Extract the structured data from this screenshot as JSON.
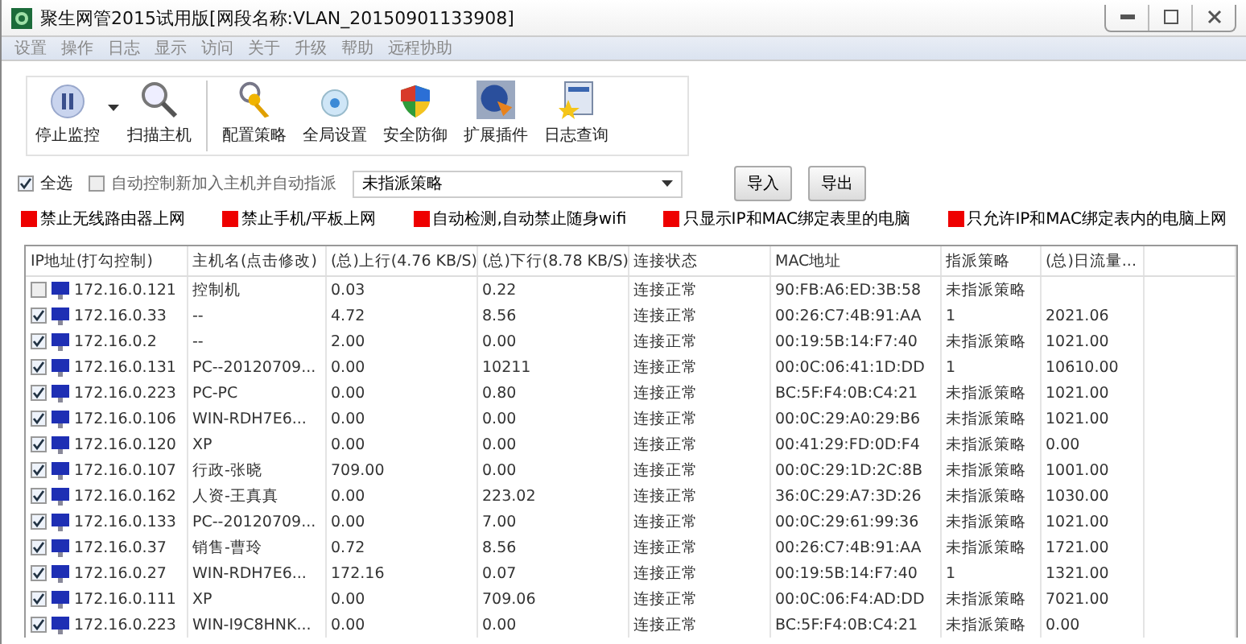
{
  "window": {
    "title": "聚生网管2015试用版[网段名称:VLAN_20150901133908]"
  },
  "menu": [
    "设置",
    "操作",
    "日志",
    "显示",
    "访问",
    "关于",
    "升级",
    "帮助",
    "远程协助"
  ],
  "toolbar": [
    {
      "kind": "pause",
      "label": "停止监控",
      "dropdown": true
    },
    {
      "kind": "search",
      "label": "扫描主机",
      "dropdown": false
    },
    {
      "kind": "key",
      "label": "配置策略",
      "dropdown": false
    },
    {
      "kind": "gear",
      "label": "全局设置",
      "dropdown": false
    },
    {
      "kind": "shield",
      "label": "安全防御",
      "dropdown": false
    },
    {
      "kind": "plugin",
      "label": "扩展插件",
      "dropdown": false
    },
    {
      "kind": "log",
      "label": "日志查询",
      "dropdown": false
    }
  ],
  "select_all": {
    "label": "全选",
    "checked": true
  },
  "auto_assign": {
    "label": "自动控制新加入主机并自动指派",
    "checked": false
  },
  "policy_select": {
    "value": "未指派策略"
  },
  "buttons": [
    "导入",
    "导出"
  ],
  "rules": [
    "禁止无线路由器上网",
    "禁止手机/平板上网",
    "自动检测,自动禁止随身wifi",
    "只显示IP和MAC绑定表里的电脑",
    "只允许IP和MAC绑定表内的电脑上网"
  ],
  "table": {
    "columns": [
      "IP地址(打勾控制)",
      "主机名(点击修改)",
      "(总)上行(4.76 KB/S)",
      "(总)下行(8.78 KB/S)",
      "连接状态",
      "MAC地址",
      "指派策略",
      "(总)日流量..."
    ],
    "rows": [
      {
        "checked": false,
        "cells": [
          "172.16.0.121",
          "控制机",
          "0.03",
          "0.22",
          "连接正常",
          "90:FB:A6:ED:3B:58",
          "未指派策略",
          ""
        ]
      },
      {
        "checked": true,
        "cells": [
          "172.16.0.33",
          "--",
          "4.72",
          "8.56",
          "连接正常",
          "00:26:C7:4B:91:AA",
          "1",
          "2021.06"
        ]
      },
      {
        "checked": true,
        "cells": [
          "172.16.0.2",
          "--",
          "2.00",
          "0.00",
          "连接正常",
          "00:19:5B:14:F7:40",
          "未指派策略",
          "1021.00"
        ]
      },
      {
        "checked": true,
        "cells": [
          "172.16.0.131",
          "PC--20120709...",
          "0.00",
          "10211",
          "连接正常",
          "00:0C:06:41:1D:DD",
          "1",
          "10610.00"
        ]
      },
      {
        "checked": true,
        "cells": [
          "172.16.0.223",
          "PC-PC",
          "0.00",
          "0.80",
          "连接正常",
          "BC:5F:F4:0B:C4:21",
          "未指派策略",
          "1021.00"
        ]
      },
      {
        "checked": true,
        "cells": [
          "172.16.0.106",
          "WIN-RDH7E6...",
          "0.00",
          "0.00",
          "连接正常",
          "00:0C:29:A0:29:B6",
          "未指派策略",
          "1021.00"
        ]
      },
      {
        "checked": true,
        "cells": [
          "172.16.0.120",
          "XP",
          "0.00",
          "0.00",
          "连接正常",
          "00:41:29:FD:0D:F4",
          "未指派策略",
          "0.00"
        ]
      },
      {
        "checked": true,
        "cells": [
          "172.16.0.107",
          "行政-张晓",
          "709.00",
          "0.00",
          "连接正常",
          "00:0C:29:1D:2C:8B",
          "未指派策略",
          "1001.00"
        ]
      },
      {
        "checked": true,
        "cells": [
          "172.16.0.162",
          "人资-王真真",
          "0.00",
          "223.02",
          "连接正常",
          "36:0C:29:A7:3D:26",
          "未指派策略",
          "1030.00"
        ]
      },
      {
        "checked": true,
        "cells": [
          "172.16.0.133",
          "PC--20120709...",
          "0.00",
          "7.00",
          "连接正常",
          "00:0C:29:61:99:36",
          "未指派策略",
          "1021.00"
        ]
      },
      {
        "checked": true,
        "cells": [
          "172.16.0.37",
          "销售-曹玲",
          "0.72",
          "8.56",
          "连接正常",
          "00:26:C7:4B:91:AA",
          "未指派策略",
          "1721.00"
        ]
      },
      {
        "checked": true,
        "cells": [
          "172.16.0.27",
          "WIN-RDH7E6...",
          "172.16",
          "0.07",
          "连接正常",
          "00:19:5B:14:F7:40",
          "1",
          "1321.00"
        ]
      },
      {
        "checked": true,
        "cells": [
          "172.16.0.111",
          "XP",
          "0.00",
          "709.06",
          "连接正常",
          "00:0C:06:F4:AD:DD",
          "未指派策略",
          "7021.00"
        ]
      },
      {
        "checked": true,
        "cells": [
          "172.16.0.223",
          "WIN-I9C8HNK...",
          "0.00",
          "0.00",
          "连接正常",
          "BC:5F:F4:0B:C4:21",
          "未指派策略",
          "0.00"
        ]
      }
    ]
  }
}
